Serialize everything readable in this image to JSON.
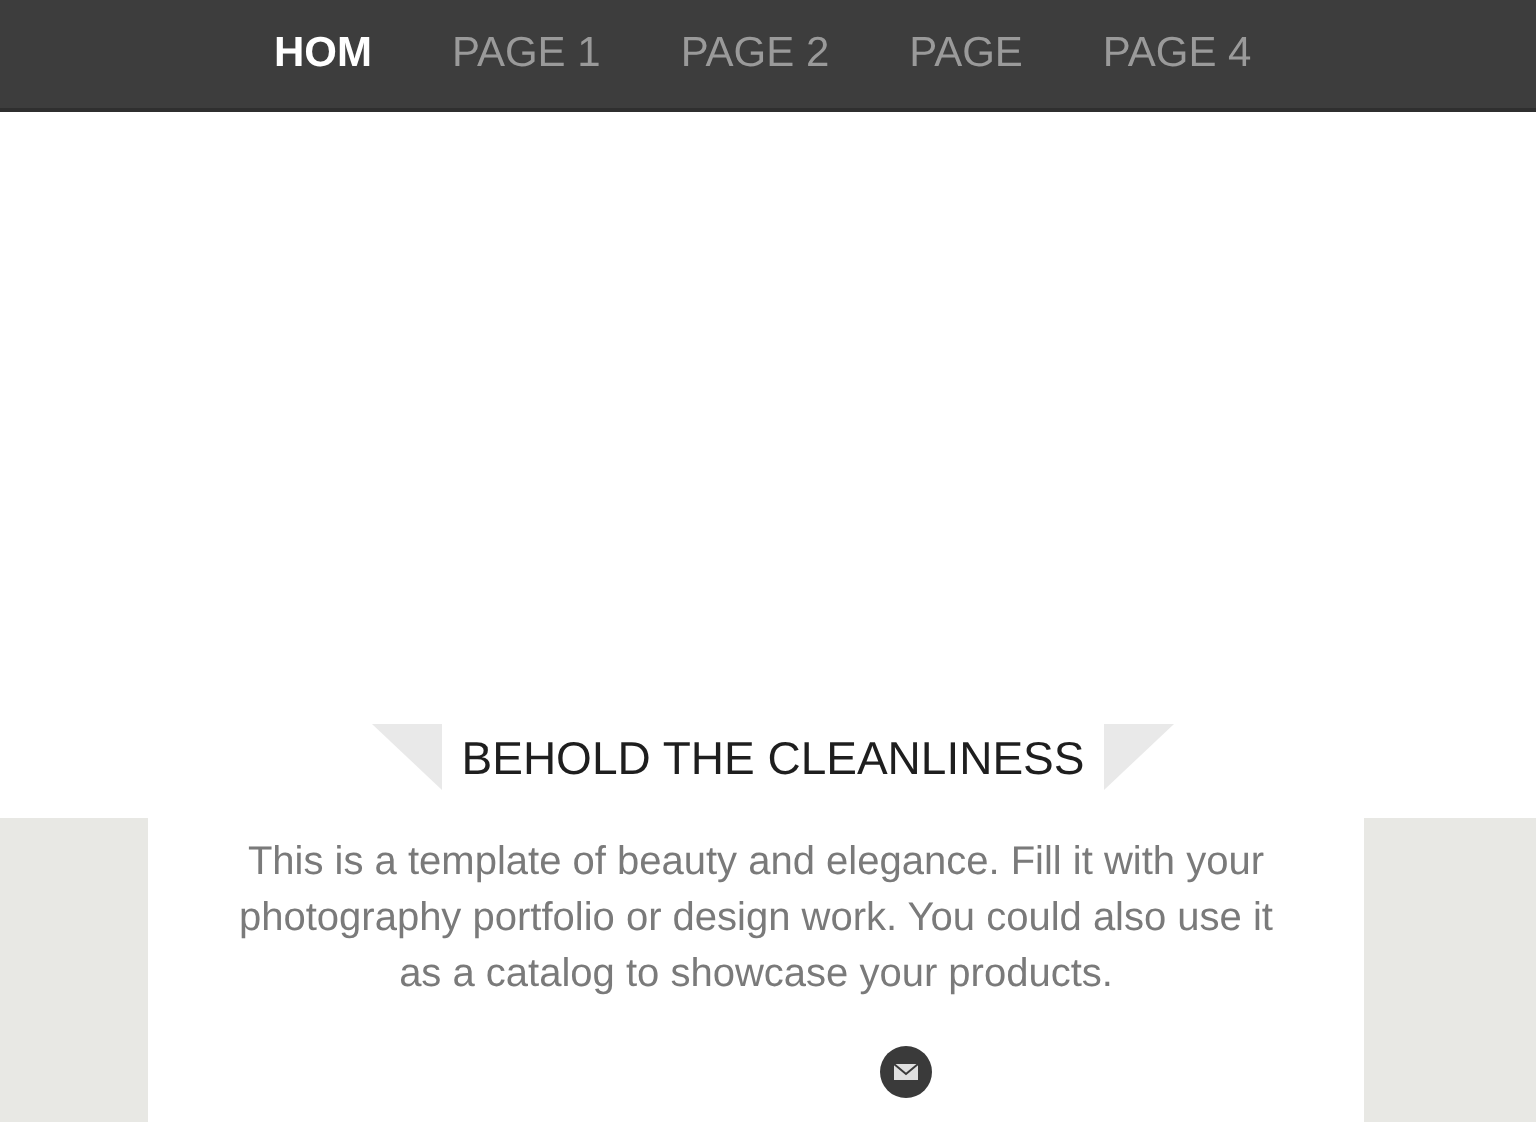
{
  "nav": {
    "items": [
      {
        "label": "HOM",
        "selected": true
      },
      {
        "label": "PAGE 1",
        "selected": false
      },
      {
        "label": "PAGE 2",
        "selected": false
      },
      {
        "label": "PAGE",
        "selected": false
      },
      {
        "label": "PAGE 4",
        "selected": false
      }
    ]
  },
  "section": {
    "heading": "BEHOLD THE CLEANLINESS",
    "text": "This is a template of beauty and elegance. Fill it with your photography portfolio or design work. You could also use it as a catalog to showcase your products."
  }
}
